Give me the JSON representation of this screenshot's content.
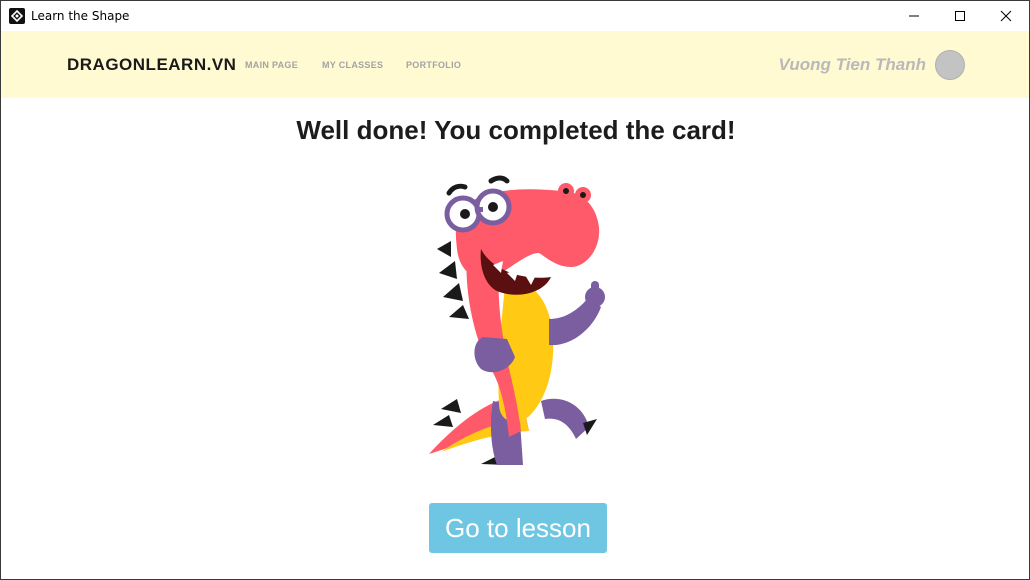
{
  "window": {
    "title": "Learn the Shape",
    "icon": "app-logo-icon",
    "controls": [
      "minimize-icon",
      "maximize-icon",
      "close-icon"
    ]
  },
  "nav": {
    "brand": "DRAGONLEARN.VN",
    "links": [
      "MAIN PAGE",
      "MY CLASSES",
      "PORTFOLIO"
    ],
    "user_name": "Vuong Tien Thanh"
  },
  "main": {
    "headline": "Well done! You completed the card!",
    "mascot": "dragon-mascot-thumbs-up",
    "cta_label": "Go to lesson"
  },
  "colors": {
    "navbar_bg": "#fffad2",
    "cta_bg": "#6ec6e3",
    "dragon_pink": "#ff5a6a",
    "dragon_yellow": "#ffc914",
    "dragon_purple": "#7a5ea0"
  }
}
